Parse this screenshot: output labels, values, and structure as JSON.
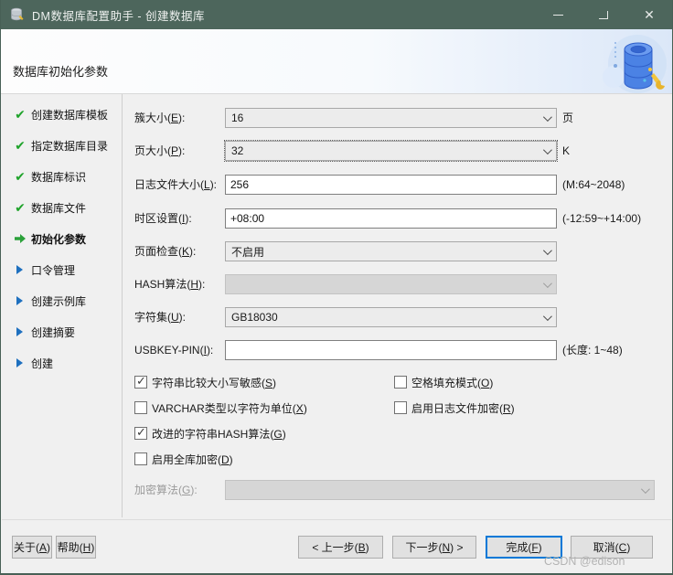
{
  "window": {
    "title": "DM数据库配置助手 - 创建数据库",
    "close_glyph": "✕"
  },
  "header": {
    "title": "数据库初始化参数"
  },
  "sidebar": {
    "items": [
      {
        "label": "创建数据库模板",
        "state": "done"
      },
      {
        "label": "指定数据库目录",
        "state": "done"
      },
      {
        "label": "数据库标识",
        "state": "done"
      },
      {
        "label": "数据库文件",
        "state": "done"
      },
      {
        "label": "初始化参数",
        "state": "current"
      },
      {
        "label": "口令管理",
        "state": "todo"
      },
      {
        "label": "创建示例库",
        "state": "todo"
      },
      {
        "label": "创建摘要",
        "state": "todo"
      },
      {
        "label": "创建",
        "state": "todo"
      }
    ]
  },
  "form": {
    "fields": [
      {
        "label": "簇大小(E):",
        "type": "select",
        "value": "16",
        "suffix": "页",
        "focused": false,
        "disabled": false
      },
      {
        "label": "页大小(P):",
        "type": "select",
        "value": "32",
        "suffix": "K",
        "focused": true,
        "disabled": false
      },
      {
        "label": "日志文件大小(L):",
        "type": "text",
        "value": "256",
        "suffix": "(M:64~2048)"
      },
      {
        "label": "时区设置(I):",
        "type": "text",
        "value": "+08:00",
        "suffix": "(-12:59~+14:00)"
      },
      {
        "label": "页面检查(K):",
        "type": "select",
        "value": "不启用",
        "suffix": "",
        "focused": false,
        "disabled": false
      },
      {
        "label": "HASH算法(H):",
        "type": "select",
        "value": "",
        "suffix": "",
        "focused": false,
        "disabled": true
      },
      {
        "label": "字符集(U):",
        "type": "select",
        "value": "GB18030",
        "suffix": "",
        "focused": false,
        "disabled": false
      },
      {
        "label": "USBKEY-PIN(I):",
        "type": "text",
        "value": "",
        "suffix": "(长度: 1~48)"
      }
    ],
    "checkboxes": [
      {
        "label": "字符串比较大小写敏感(S)",
        "checked": true
      },
      {
        "label": "空格填充模式(O)",
        "checked": false
      },
      {
        "label": "VARCHAR类型以字符为单位(X)",
        "checked": false
      },
      {
        "label": "启用日志文件加密(R)",
        "checked": false
      },
      {
        "label": "改进的字符串HASH算法(G)",
        "checked": true
      },
      {
        "label": "启用全库加密(D)",
        "checked": false
      }
    ],
    "encrypt_field": {
      "label": "加密算法(G):",
      "value": "",
      "disabled": true
    }
  },
  "footer": {
    "about": "关于(A)",
    "help": "帮助(H)",
    "back": "< 上一步(B)",
    "next": "下一步(N) >",
    "finish": "完成(F)",
    "cancel": "取消(C)"
  },
  "watermark": "CSDN @edison"
}
